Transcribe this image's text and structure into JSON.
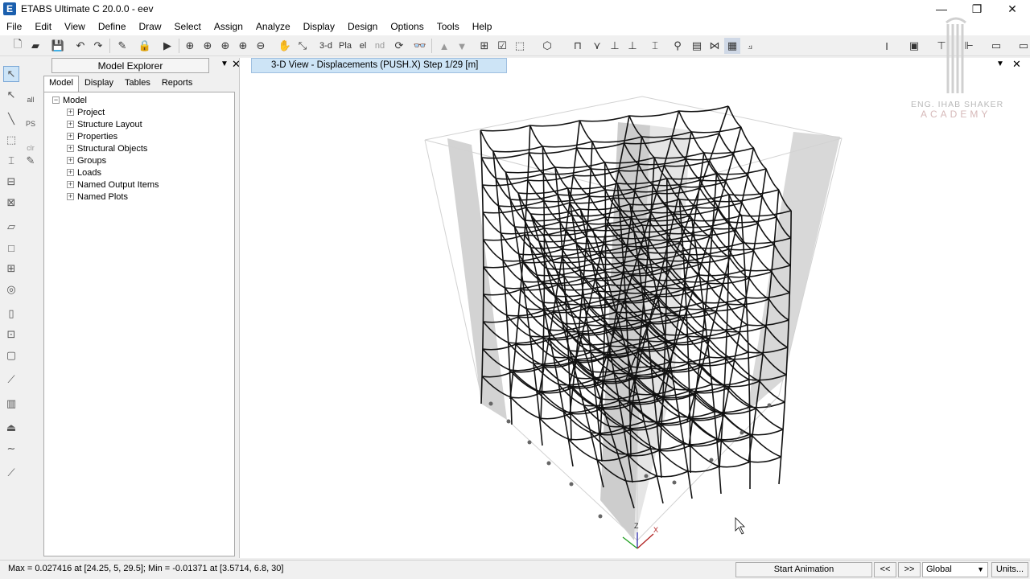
{
  "app": {
    "title": "ETABS Ultimate C 20.0.0 - eev",
    "logo_letter": "E"
  },
  "window_controls": {
    "minimize": "—",
    "restore": "❐",
    "close": "✕"
  },
  "menu": [
    "File",
    "Edit",
    "View",
    "Define",
    "Draw",
    "Select",
    "Assign",
    "Analyze",
    "Display",
    "Design",
    "Options",
    "Tools",
    "Help"
  ],
  "toolbar": {
    "threed_label": "3-d",
    "plan_label": "Pla",
    "elev_label": "el",
    "nd_label": "nd"
  },
  "left_tools": {
    "all_label": "all",
    "ps_label": "PS",
    "clr_label": "clr"
  },
  "explorer": {
    "title": "Model Explorer",
    "tabs": [
      "Model",
      "Display",
      "Tables",
      "Reports"
    ],
    "root": "Model",
    "items": [
      "Project",
      "Structure Layout",
      "Properties",
      "Structural Objects",
      "Groups",
      "Loads",
      "Named Output Items",
      "Named Plots"
    ]
  },
  "view": {
    "tab_title": "3-D View  - Displacements (PUSH.X)  Step 1/29  [m]",
    "axis_z": "Z",
    "axis_x": "X"
  },
  "watermark": {
    "line1": "ENG. IHAB SHAKER",
    "line2": "ACADEMY"
  },
  "status": {
    "text": "Max = 0.027416 at [24.25, 5, 29.5];  Min = -0.01371 at [3.5714, 6.8, 30]",
    "start_animation": "Start Animation",
    "prev": "<<",
    "next": ">>",
    "coord_system": "Global",
    "units": "Units..."
  },
  "colors": {
    "accent": "#1b5fae",
    "tab_bg": "#cde4f6",
    "frame": "#111111",
    "wall": "#b8b8b8"
  }
}
